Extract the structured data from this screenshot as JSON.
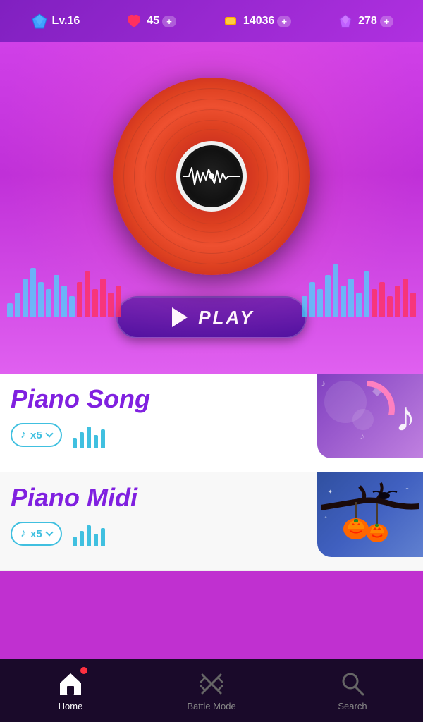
{
  "topBar": {
    "level": "Lv.16",
    "hearts": "45",
    "coins": "14036",
    "gems": "278",
    "plusLabel": "+"
  },
  "playButton": {
    "label": "PLAY"
  },
  "songCards": [
    {
      "title": "Piano Song",
      "ticketLabel": "♪ x5",
      "type": "piano-song"
    },
    {
      "title": "Piano Midi",
      "ticketLabel": "♪ x5",
      "type": "piano-midi"
    }
  ],
  "bottomNav": {
    "items": [
      {
        "label": "Home",
        "active": true
      },
      {
        "label": "Battle Mode",
        "active": false
      },
      {
        "label": "Search",
        "active": false
      }
    ]
  },
  "eqBarsLeft": [
    20,
    35,
    55,
    70,
    50,
    40,
    60,
    45,
    30,
    50,
    65,
    40
  ],
  "eqBarsRight": [
    30,
    50,
    40,
    60,
    75,
    45,
    55,
    35,
    65,
    40,
    50,
    30
  ],
  "musicBarsLeft1": [
    20,
    28,
    35,
    22,
    30
  ],
  "musicBarsLeft2": [
    20,
    28,
    35,
    22,
    30
  ]
}
